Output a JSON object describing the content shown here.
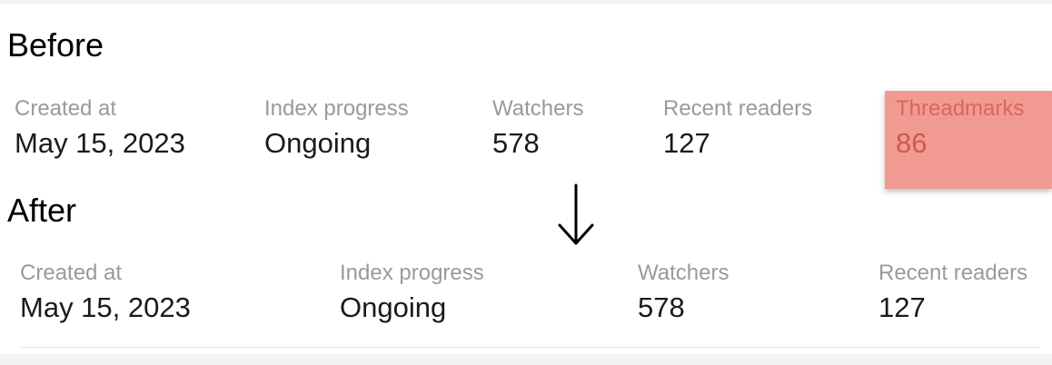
{
  "before": {
    "heading": "Before",
    "stats": [
      {
        "label": "Created at",
        "value": "May 15, 2023"
      },
      {
        "label": "Index progress",
        "value": "Ongoing"
      },
      {
        "label": "Watchers",
        "value": "578"
      },
      {
        "label": "Recent readers",
        "value": "127"
      },
      {
        "label": "Threadmarks",
        "value": "86"
      }
    ]
  },
  "after": {
    "heading": "After",
    "stats": [
      {
        "label": "Created at",
        "value": "May 15, 2023"
      },
      {
        "label": "Index progress",
        "value": "Ongoing"
      },
      {
        "label": "Watchers",
        "value": "578"
      },
      {
        "label": "Recent readers",
        "value": "127"
      }
    ]
  },
  "icons": {
    "transition": "arrow-down-icon"
  },
  "colors": {
    "highlight": "#f19a92",
    "label": "#9a9a9a",
    "value": "#1a1a1a"
  }
}
